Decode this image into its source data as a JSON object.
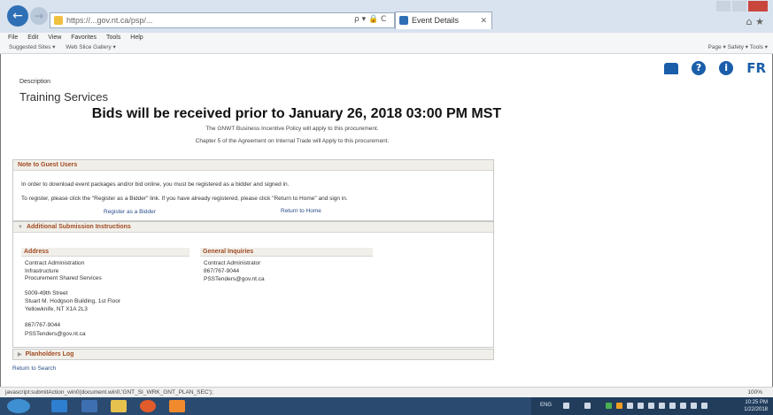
{
  "browser": {
    "address_url": "https://...gov.nt.ca/psp/...",
    "address_tools": "ρ ▾ 🔒 C",
    "tab_title": "Event Details",
    "menu": [
      "File",
      "Edit",
      "View",
      "Favorites",
      "Tools",
      "Help"
    ],
    "favorites": [
      "Suggested Sites ▾",
      "Web Slice Gallery ▾"
    ],
    "commandbar": "Page ▾  Safety ▾  Tools ▾",
    "status_text": "javascript:submitAction_win0(document.win0,'GNT_SI_WRK_GNT_PLAN_SEC');",
    "zoom": "100%"
  },
  "page_icons": {
    "help": "?",
    "info": "i",
    "lang": "FR"
  },
  "content": {
    "description_label": "Description",
    "description_value": "Training Services",
    "bids_notice": "Bids will be received prior to January 26, 2018 03:00 PM MST",
    "policy_1": "The GNWT Business Incentive Policy will apply to this procurement.",
    "policy_2": "Chapter 5 of the Agreement on Internal Trade will Apply to this procurement."
  },
  "guest_panel": {
    "title": "Note to Guest Users",
    "line_1": "In order to download event packages and/or bid online, you must be registered as a bidder and signed in.",
    "line_2": "To register, please click the \"Register as a Bidder\" link. If you have already registered, please click \"Return to Home\" and sign in.",
    "register_link": "Register as a Bidder",
    "home_link": "Return to Home"
  },
  "submission_panel": {
    "title": "Additional Submission Instructions",
    "address_head": "Address",
    "address_lines": [
      "Contract Administration",
      "Infrastructure",
      "Procurement Shared Services",
      "",
      "5009-49th Street",
      "Stuart M. Hodgson Building, 1st Floor",
      "Yellowknife, NT X1A 2L3",
      "",
      "867/767-9044",
      "PSSTenders@gov.nt.ca"
    ],
    "inquiries_head": "General Inquiries",
    "inquiries_lines": [
      "Contract Administrator",
      "867/767-9044",
      "PSSTenders@gov.nt.ca"
    ]
  },
  "planholders_panel": {
    "title": "Planholders Log"
  },
  "return_link": "Return to Search",
  "taskbar": {
    "lang": "ENG",
    "time": "10:25 PM",
    "date": "1/22/2018"
  },
  "colors": {
    "accent": "#1a5eaa",
    "panel_title": "#a04a22",
    "link": "#2a4e8a"
  }
}
